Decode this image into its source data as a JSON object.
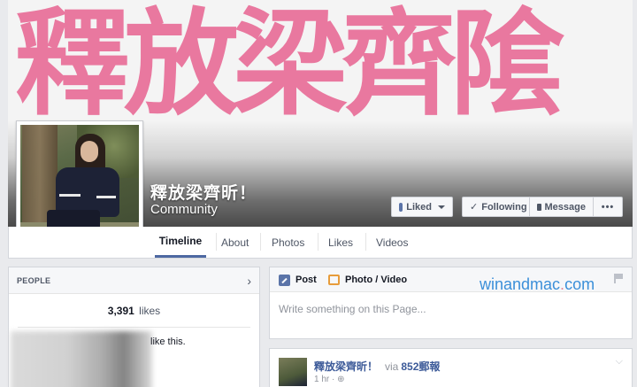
{
  "cover": {
    "banner_text": "釋放梁齊隂"
  },
  "page": {
    "name": "釋放梁齊昕！",
    "category": "Community"
  },
  "actions": {
    "liked": "Liked",
    "following": "Following",
    "message": "Message",
    "more": "•••"
  },
  "nav": {
    "tabs": [
      "Timeline",
      "About",
      "Photos",
      "Likes",
      "Videos"
    ],
    "active": "Timeline"
  },
  "people": {
    "title": "PEOPLE",
    "likes_count": "3,391",
    "likes_unit": "likes",
    "like_this": "like this."
  },
  "composer": {
    "tab_post": "Post",
    "tab_photo": "Photo / Video",
    "placeholder": "Write something on this Page..."
  },
  "watermark": {
    "part1": "winandmac",
    "dot": ".",
    "part2": "com"
  },
  "post": {
    "author": "釋放梁齊昕！",
    "via_label": "via",
    "via_target": "852郵報",
    "time": "1 hr · ⊕"
  },
  "colors": {
    "accent": "#4e69a2",
    "banner_pink": "#e9789f",
    "link": "#3b5998"
  }
}
